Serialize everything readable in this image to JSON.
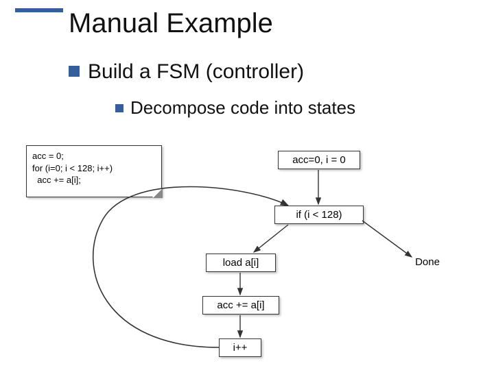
{
  "title": "Manual Example",
  "bullets": {
    "l1": "Build a FSM (controller)",
    "l2": "Decompose code into states"
  },
  "code": {
    "line1": "acc = 0;",
    "line2": "for (i=0; i < 128; i++)",
    "line3": "  acc += a[i];"
  },
  "nodes": {
    "init": "acc=0, i = 0",
    "cond": "if (i < 128)",
    "load": "load a[i]",
    "acc": "acc += a[i]",
    "inc": "i++",
    "done": "Done"
  }
}
